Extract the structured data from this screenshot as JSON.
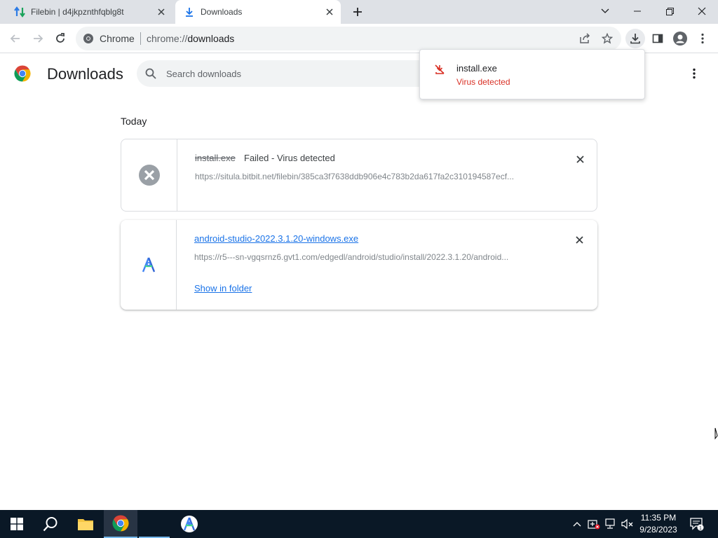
{
  "tabs": [
    {
      "title": "Filebin | d4jkpznthfqblg8t",
      "icon": "filebin-arrows-icon"
    },
    {
      "title": "Downloads",
      "icon": "download-icon"
    }
  ],
  "omnibox": {
    "chip": "Chrome",
    "url_scheme": "chrome://",
    "url_host": "downloads"
  },
  "header": {
    "title": "Downloads",
    "search_placeholder": "Search downloads"
  },
  "bubble": {
    "filename": "install.exe",
    "status": "Virus detected"
  },
  "section": {
    "label": "Today"
  },
  "downloads": [
    {
      "filename": "install.exe",
      "status": "Failed - Virus detected",
      "url": "https://situla.bitbit.net/filebin/385ca3f7638ddb906e4c783b2da617fa2c310194587ecf..."
    },
    {
      "filename": "android-studio-2022.3.1.20-windows.exe",
      "url": "https://r5---sn-vgqsrnz6.gvt1.com/edgedl/android/studio/install/2022.3.1.20/android...",
      "action": "Show in folder"
    }
  ],
  "taskbar": {
    "time": "11:35 PM",
    "date": "9/28/2023",
    "notification_count": "1"
  },
  "colors": {
    "error_red": "#d93025",
    "link_blue": "#1a73e8",
    "taskbar": "#0a1826",
    "tabstrip": "#dee1e6"
  }
}
